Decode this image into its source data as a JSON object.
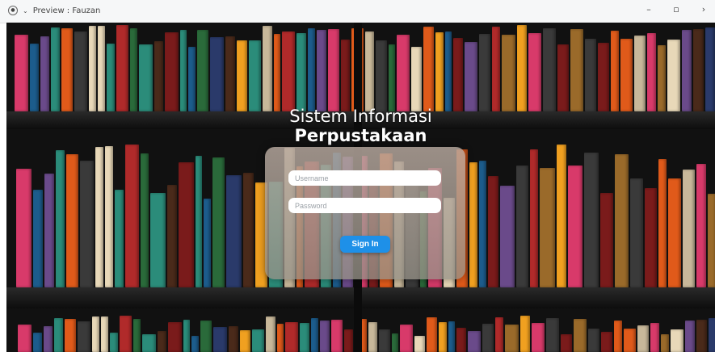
{
  "window": {
    "title": "Preview : Fauzan",
    "controls": {
      "minimize": "–",
      "restore": "▫",
      "more": "›"
    }
  },
  "login": {
    "title_line1": "Sistem Informasi",
    "title_line2": "Perpustakaan",
    "username_placeholder": "Username",
    "password_placeholder": "Password",
    "button_label": "Sign In"
  },
  "colors": {
    "accent": "#1e90e8",
    "titlebar": "#f6f7f8",
    "background": "#111111"
  },
  "icons": [
    "app-icon",
    "chevron-down-icon",
    "minimize-icon",
    "restore-icon",
    "chevron-right-icon"
  ]
}
